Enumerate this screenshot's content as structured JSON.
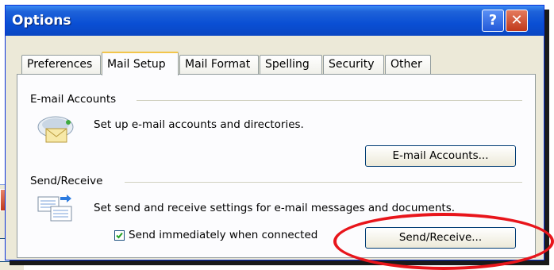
{
  "window": {
    "title": "Options",
    "help_label": "?",
    "close_label": "✕"
  },
  "background_window": {
    "close_label": "✕"
  },
  "tabs": [
    {
      "label": "Preferences",
      "active": false
    },
    {
      "label": "Mail Setup",
      "active": true
    },
    {
      "label": "Mail Format",
      "active": false
    },
    {
      "label": "Spelling",
      "active": false
    },
    {
      "label": "Security",
      "active": false
    },
    {
      "label": "Other",
      "active": false
    }
  ],
  "email_accounts": {
    "group_label": "E-mail Accounts",
    "description": "Set up e-mail accounts and directories.",
    "button_label": "E-mail Accounts...",
    "icon": "email-accounts-icon"
  },
  "send_receive": {
    "group_label": "Send/Receive",
    "description": "Set send and receive settings for e-mail messages and documents.",
    "checkbox_label": "Send immediately when connected",
    "checkbox_checked": true,
    "button_label": "Send/Receive...",
    "icon": "send-receive-icon"
  },
  "colors": {
    "titlebar": "#0a4fd4",
    "highlight": "#e8151b",
    "check": "#21a121"
  }
}
